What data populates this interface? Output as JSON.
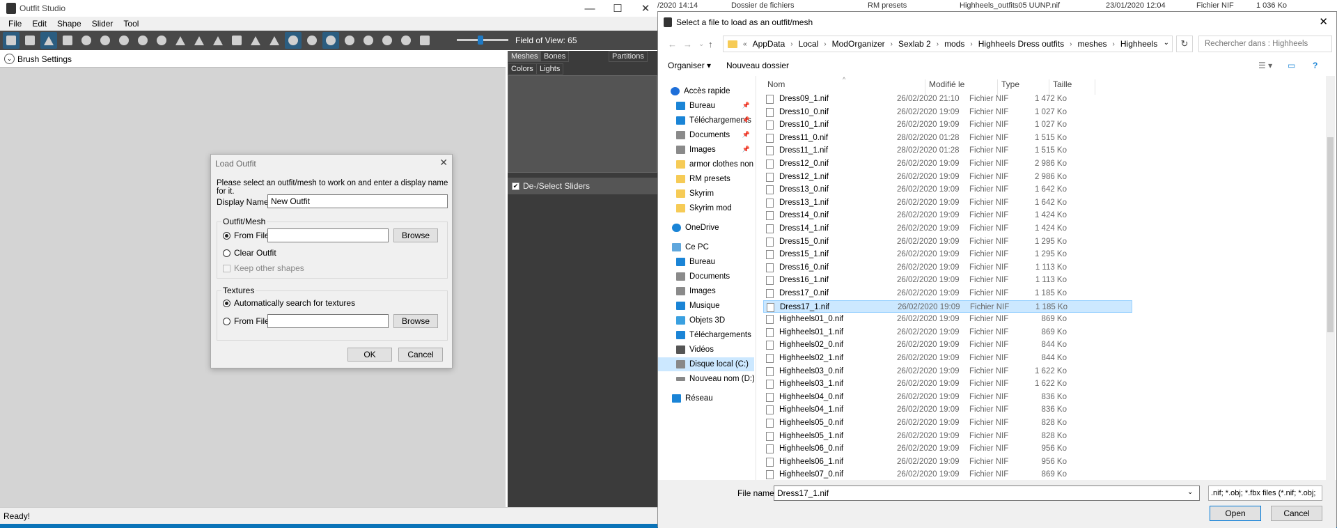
{
  "outfit_studio": {
    "title": "Outfit Studio",
    "menu": [
      "File",
      "Edit",
      "Shape",
      "Slider",
      "Tool"
    ],
    "fov_label": "Field of View: 65",
    "fov_value": 0.35,
    "brush_settings": "Brush Settings",
    "tabs": {
      "meshes": "Meshes",
      "bones": "Bones",
      "partitions": "Partitions",
      "colors": "Colors",
      "lights": "Lights"
    },
    "sliders_label": "De-/Select Sliders",
    "status": "Ready!"
  },
  "load_outfit": {
    "title": "Load Outfit",
    "description": "Please select an outfit/mesh to work on and enter a display name for it.",
    "display_name_label": "Display Name",
    "display_name_value": "New Outfit",
    "outfit_group": "Outfit/Mesh",
    "from_file": "From File",
    "browse": "Browse",
    "clear_outfit": "Clear Outfit",
    "keep_other_shapes": "Keep other shapes",
    "textures_group": "Textures",
    "auto_search": "Automatically search for textures",
    "from_file_2": "From File",
    "browse_2": "Browse",
    "ok": "OK",
    "cancel": "Cancel"
  },
  "background_explorer": {
    "date": "/2020 14:14",
    "type": "Dossier de fichiers",
    "folder": "RM presets",
    "file": "Highheels_outfits05 UUNP.nif",
    "file_date": "23/01/2020 12:04",
    "file_type": "Fichier NIF",
    "file_size": "1 036 Ko"
  },
  "file_dialog": {
    "title": "Select a file to load as an outfit/mesh",
    "breadcrumb": [
      "AppData",
      "Local",
      "ModOrganizer",
      "Sexlab 2",
      "mods",
      "Highheels Dress outfits",
      "meshes",
      "Highheels"
    ],
    "breadcrumb_prefix": "«",
    "search_placeholder": "Rechercher dans : Highheels",
    "organize": "Organiser ▾",
    "new_folder": "Nouveau dossier",
    "columns": {
      "name": "Nom",
      "modified": "Modifié le",
      "type": "Type",
      "size": "Taille"
    },
    "sidebar": [
      {
        "label": "Accès rapide",
        "icon": "star-icon",
        "color": "#1e6fd9"
      },
      {
        "label": "Bureau",
        "icon": "desktop-icon",
        "color": "#1a84d6",
        "pin": true
      },
      {
        "label": "Téléchargements",
        "icon": "download-icon",
        "color": "#1a84d6",
        "pin": true
      },
      {
        "label": "Documents",
        "icon": "documents-icon",
        "color": "#8a8a8a",
        "pin": true
      },
      {
        "label": "Images",
        "icon": "images-icon",
        "color": "#8a8a8a",
        "pin": true
      },
      {
        "label": "armor clothes non l",
        "icon": "folder-icon",
        "color": "#f6cb56"
      },
      {
        "label": "RM presets",
        "icon": "folder-icon",
        "color": "#f6cb56"
      },
      {
        "label": "Skyrim",
        "icon": "folder-icon",
        "color": "#f6cb56"
      },
      {
        "label": "Skyrim mod",
        "icon": "folder-icon",
        "color": "#f6cb56"
      },
      {
        "label": "OneDrive",
        "icon": "cloud-icon",
        "color": "#1a84d6"
      },
      {
        "label": "Ce PC",
        "icon": "pc-icon",
        "color": "#5fa7dd"
      },
      {
        "label": "Bureau",
        "icon": "desktop-icon",
        "color": "#1a84d6"
      },
      {
        "label": "Documents",
        "icon": "documents-icon",
        "color": "#8a8a8a"
      },
      {
        "label": "Images",
        "icon": "images-icon",
        "color": "#8a8a8a"
      },
      {
        "label": "Musique",
        "icon": "music-icon",
        "color": "#1a84d6"
      },
      {
        "label": "Objets 3D",
        "icon": "cube-icon",
        "color": "#3aa0e0"
      },
      {
        "label": "Téléchargements",
        "icon": "download-icon",
        "color": "#1a84d6"
      },
      {
        "label": "Vidéos",
        "icon": "video-icon",
        "color": "#555"
      },
      {
        "label": "Disque local (C:)",
        "icon": "drive-icon",
        "color": "#888",
        "selected": true
      },
      {
        "label": "Nouveau nom (D:)",
        "icon": "drive-icon",
        "color": "#888"
      },
      {
        "label": "Réseau",
        "icon": "network-icon",
        "color": "#1a84d6"
      }
    ],
    "files": [
      {
        "name": "Dress09_1.nif",
        "date": "26/02/2020 21:10",
        "type": "Fichier NIF",
        "size": "1 472 Ko"
      },
      {
        "name": "Dress10_0.nif",
        "date": "26/02/2020 19:09",
        "type": "Fichier NIF",
        "size": "1 027 Ko"
      },
      {
        "name": "Dress10_1.nif",
        "date": "26/02/2020 19:09",
        "type": "Fichier NIF",
        "size": "1 027 Ko"
      },
      {
        "name": "Dress11_0.nif",
        "date": "28/02/2020 01:28",
        "type": "Fichier NIF",
        "size": "1 515 Ko"
      },
      {
        "name": "Dress11_1.nif",
        "date": "28/02/2020 01:28",
        "type": "Fichier NIF",
        "size": "1 515 Ko"
      },
      {
        "name": "Dress12_0.nif",
        "date": "26/02/2020 19:09",
        "type": "Fichier NIF",
        "size": "2 986 Ko"
      },
      {
        "name": "Dress12_1.nif",
        "date": "26/02/2020 19:09",
        "type": "Fichier NIF",
        "size": "2 986 Ko"
      },
      {
        "name": "Dress13_0.nif",
        "date": "26/02/2020 19:09",
        "type": "Fichier NIF",
        "size": "1 642 Ko"
      },
      {
        "name": "Dress13_1.nif",
        "date": "26/02/2020 19:09",
        "type": "Fichier NIF",
        "size": "1 642 Ko"
      },
      {
        "name": "Dress14_0.nif",
        "date": "26/02/2020 19:09",
        "type": "Fichier NIF",
        "size": "1 424 Ko"
      },
      {
        "name": "Dress14_1.nif",
        "date": "26/02/2020 19:09",
        "type": "Fichier NIF",
        "size": "1 424 Ko"
      },
      {
        "name": "Dress15_0.nif",
        "date": "26/02/2020 19:09",
        "type": "Fichier NIF",
        "size": "1 295 Ko"
      },
      {
        "name": "Dress15_1.nif",
        "date": "26/02/2020 19:09",
        "type": "Fichier NIF",
        "size": "1 295 Ko"
      },
      {
        "name": "Dress16_0.nif",
        "date": "26/02/2020 19:09",
        "type": "Fichier NIF",
        "size": "1 113 Ko"
      },
      {
        "name": "Dress16_1.nif",
        "date": "26/02/2020 19:09",
        "type": "Fichier NIF",
        "size": "1 113 Ko"
      },
      {
        "name": "Dress17_0.nif",
        "date": "26/02/2020 19:09",
        "type": "Fichier NIF",
        "size": "1 185 Ko"
      },
      {
        "name": "Dress17_1.nif",
        "date": "26/02/2020 19:09",
        "type": "Fichier NIF",
        "size": "1 185 Ko",
        "selected": true
      },
      {
        "name": "Highheels01_0.nif",
        "date": "26/02/2020 19:09",
        "type": "Fichier NIF",
        "size": "869 Ko"
      },
      {
        "name": "Highheels01_1.nif",
        "date": "26/02/2020 19:09",
        "type": "Fichier NIF",
        "size": "869 Ko"
      },
      {
        "name": "Highheels02_0.nif",
        "date": "26/02/2020 19:09",
        "type": "Fichier NIF",
        "size": "844 Ko"
      },
      {
        "name": "Highheels02_1.nif",
        "date": "26/02/2020 19:09",
        "type": "Fichier NIF",
        "size": "844 Ko"
      },
      {
        "name": "Highheels03_0.nif",
        "date": "26/02/2020 19:09",
        "type": "Fichier NIF",
        "size": "1 622 Ko"
      },
      {
        "name": "Highheels03_1.nif",
        "date": "26/02/2020 19:09",
        "type": "Fichier NIF",
        "size": "1 622 Ko"
      },
      {
        "name": "Highheels04_0.nif",
        "date": "26/02/2020 19:09",
        "type": "Fichier NIF",
        "size": "836 Ko"
      },
      {
        "name": "Highheels04_1.nif",
        "date": "26/02/2020 19:09",
        "type": "Fichier NIF",
        "size": "836 Ko"
      },
      {
        "name": "Highheels05_0.nif",
        "date": "26/02/2020 19:09",
        "type": "Fichier NIF",
        "size": "828 Ko"
      },
      {
        "name": "Highheels05_1.nif",
        "date": "26/02/2020 19:09",
        "type": "Fichier NIF",
        "size": "828 Ko"
      },
      {
        "name": "Highheels06_0.nif",
        "date": "26/02/2020 19:09",
        "type": "Fichier NIF",
        "size": "956 Ko"
      },
      {
        "name": "Highheels06_1.nif",
        "date": "26/02/2020 19:09",
        "type": "Fichier NIF",
        "size": "956 Ko"
      },
      {
        "name": "Highheels07_0.nif",
        "date": "26/02/2020 19:09",
        "type": "Fichier NIF",
        "size": "869 Ko"
      }
    ],
    "file_name_label": "File name:",
    "file_name_value": "Dress17_1.nif",
    "file_type": ".nif; *.obj; *.fbx files (*.nif; *.obj;",
    "open": "Open",
    "cancel": "Cancel"
  }
}
